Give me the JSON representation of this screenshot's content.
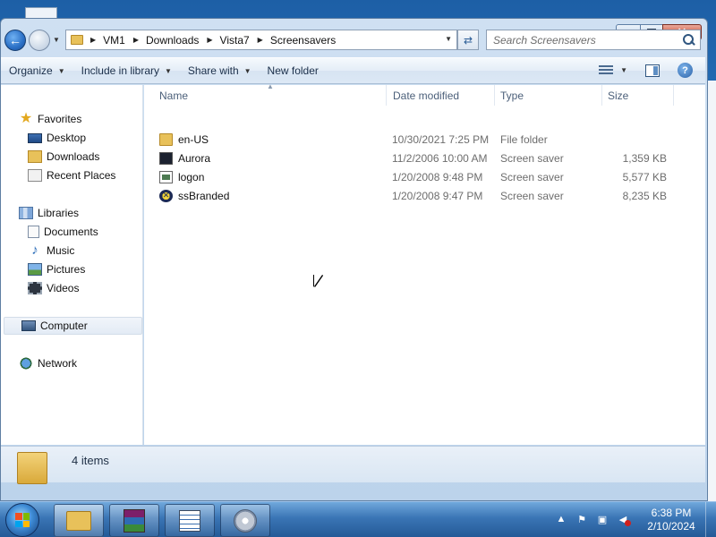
{
  "window": {
    "address": {
      "crumbs": [
        "VM1",
        "Downloads",
        "Vista7",
        "Screensavers"
      ]
    },
    "search": {
      "placeholder": "Search Screensavers"
    }
  },
  "commands": {
    "organize": "Organize",
    "include_in_library": "Include in library",
    "share_with": "Share with",
    "new_folder": "New folder"
  },
  "navpane": {
    "favorites": {
      "label": "Favorites",
      "items": [
        "Desktop",
        "Downloads",
        "Recent Places"
      ]
    },
    "libraries": {
      "label": "Libraries",
      "items": [
        "Documents",
        "Music",
        "Pictures",
        "Videos"
      ]
    },
    "computer": "Computer",
    "network": "Network"
  },
  "columns": {
    "name": "Name",
    "date_modified": "Date modified",
    "type": "Type",
    "size": "Size"
  },
  "files": [
    {
      "icon": "folder-icon",
      "name": "en-US",
      "date": "10/30/2021 7:25 PM",
      "type": "File folder",
      "size": ""
    },
    {
      "icon": "aurora-screensaver-icon",
      "name": "Aurora",
      "date": "11/2/2006 10:00 AM",
      "type": "Screen saver",
      "size": "1,359 KB"
    },
    {
      "icon": "logon-screensaver-icon",
      "name": "logon",
      "date": "1/20/2008 9:48 PM",
      "type": "Screen saver",
      "size": "5,577 KB"
    },
    {
      "icon": "ssbranded-screensaver-icon",
      "name": "ssBranded",
      "date": "1/20/2008 9:47 PM",
      "type": "Screen saver",
      "size": "8,235 KB"
    }
  ],
  "details": {
    "item_count": "4 items"
  },
  "taskbar": {
    "apps": [
      "windows-explorer-icon",
      "winrar-icon",
      "notepad-icon",
      "media-player-icon"
    ],
    "clock": {
      "time": "6:38 PM",
      "date": "2/10/2024"
    }
  },
  "colors": {
    "window_frame": "#bcd3eb",
    "close_button": "#c2452d",
    "taskbar": "#245a97"
  }
}
